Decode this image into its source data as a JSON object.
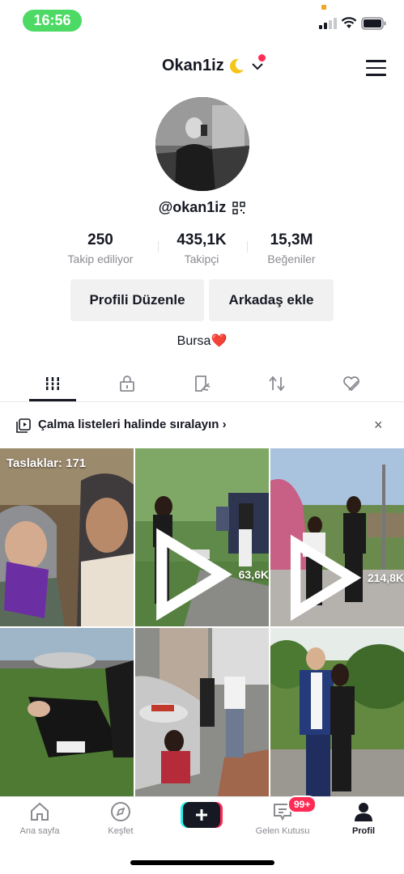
{
  "status_bar": {
    "time": "16:56"
  },
  "header": {
    "username": "Okan1iz"
  },
  "profile": {
    "handle": "@okan1iz",
    "stats": [
      {
        "value": "250",
        "label": "Takip ediliyor"
      },
      {
        "value": "435,1K",
        "label": "Takipçi"
      },
      {
        "value": "15,3M",
        "label": "Beğeniler"
      }
    ],
    "edit_button": "Profili Düzenle",
    "add_friend_button": "Arkadaş ekle",
    "bio": "Bursa",
    "bio_emoji": "❤️"
  },
  "tabs": [
    "videos-grid-icon",
    "lock-icon",
    "tagged-icon",
    "repost-icon",
    "liked-icon"
  ],
  "playlist_banner": {
    "text": "Çalma listeleri halinde sıralayın",
    "arrow": "›",
    "close": "×"
  },
  "videos": [
    {
      "draft_label": "Taslaklar: 171",
      "views": ""
    },
    {
      "draft_label": "",
      "views": "63,6K"
    },
    {
      "draft_label": "",
      "views": "214,8K"
    },
    {
      "draft_label": "",
      "views": ""
    },
    {
      "draft_label": "",
      "views": ""
    },
    {
      "draft_label": "",
      "views": ""
    }
  ],
  "bottom_nav": {
    "home": "Ana sayfa",
    "discover": "Keşfet",
    "inbox": "Gelen Kutusu",
    "inbox_badge": "99+",
    "profile": "Profil"
  },
  "colors": {
    "accent": "#fe2c55",
    "cyan": "#25f4ee",
    "time_pill": "#4cd964"
  }
}
